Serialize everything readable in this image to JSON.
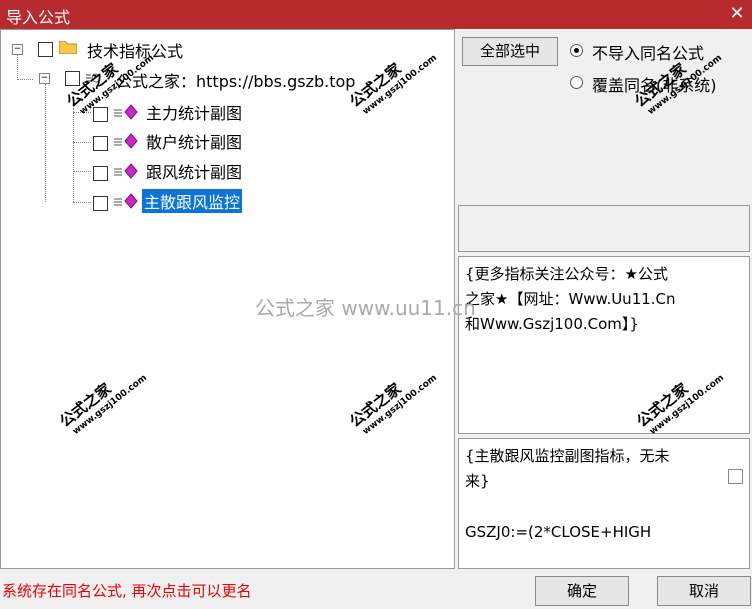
{
  "window": {
    "title": "导入公式",
    "close_icon": "close-icon"
  },
  "tree": {
    "root_label": "技术指标公式",
    "child_label": "公式之家：https://bbs.gszb.top",
    "items": [
      {
        "label": "主力统计副图"
      },
      {
        "label": "散户统计副图"
      },
      {
        "label": "跟风统计副图"
      },
      {
        "label": "主散跟风监控"
      }
    ],
    "selected_index": 3
  },
  "options": {
    "select_all_label": "全部选中",
    "radio_skip_label": "不导入同名公式",
    "radio_overwrite_label": "覆盖同名(非系统)",
    "selected": "skip"
  },
  "info_panel": {
    "line1": "{更多指标关注公众号：★公式",
    "line2": "之家★【网址：Www.Uu11.Cn",
    "line3": "和Www.Gszj100.Com】}"
  },
  "code_panel": {
    "line1": "{主散跟风监控副图指标，无未",
    "line2": "来}",
    "line3": "GSZJ0:=(2*CLOSE+HIGH"
  },
  "status_text": "系统存在同名公式, 再次点击可以更名",
  "buttons": {
    "ok": "确定",
    "cancel": "取消"
  },
  "watermark": {
    "big": "公式之家",
    "small": "www.gszj100.com",
    "center": "公式之家 www.uu11.cn"
  },
  "colors": {
    "title_bar": "#b72b2f",
    "selection": "#0a74d8",
    "status": "#e00000"
  }
}
